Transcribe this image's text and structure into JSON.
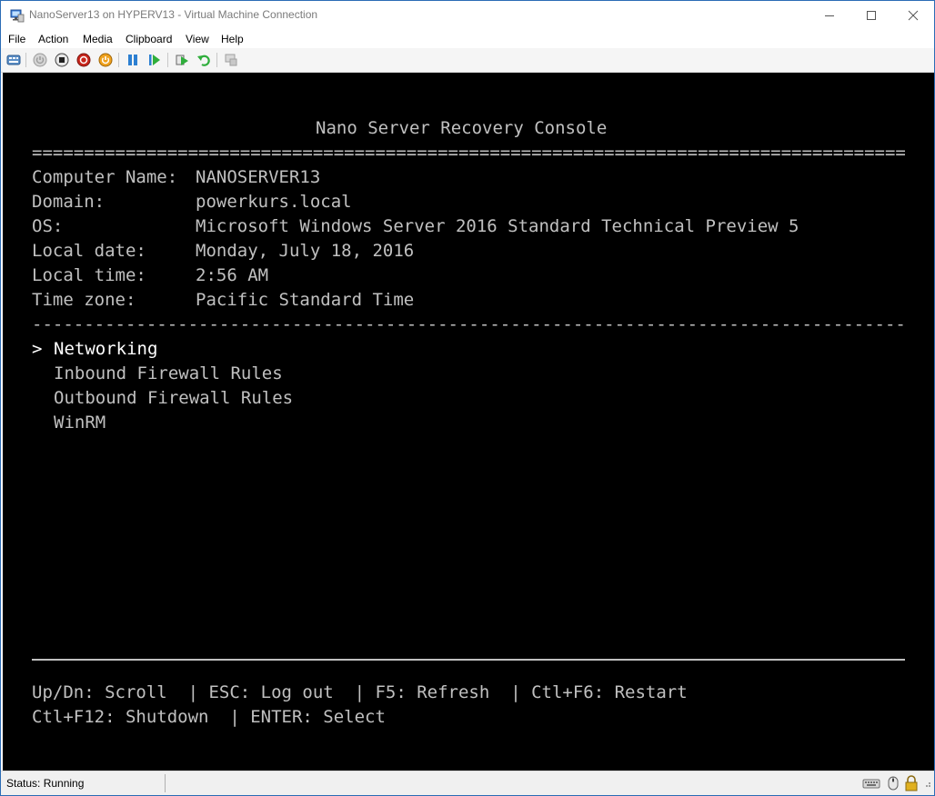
{
  "window": {
    "title": "NanoServer13 on HYPERV13 - Virtual Machine Connection"
  },
  "menu": [
    "File",
    "Action",
    "Media",
    "Clipboard",
    "View",
    "Help"
  ],
  "toolbar_icons": [
    "ctrl-alt-del-icon",
    "start-icon",
    "turn-off-icon",
    "shutdown-icon",
    "power-icon",
    "pause-icon",
    "resume-icon",
    "checkpoint-icon",
    "revert-icon",
    "enhanced-session-icon"
  ],
  "console": {
    "heading": "Nano Server Recovery Console",
    "double_rule": "================================================================================================",
    "info": [
      {
        "label": "Computer Name:",
        "value": "NANOSERVER13"
      },
      {
        "label": "Domain:",
        "value": "powerkurs.local"
      },
      {
        "label": "OS:",
        "value": "Microsoft Windows Server 2016 Standard Technical Preview 5"
      },
      {
        "label": "Local date:",
        "value": "Monday, July 18, 2016"
      },
      {
        "label": "Local time:",
        "value": "2:56 AM"
      },
      {
        "label": "Time zone:",
        "value": "Pacific Standard Time"
      }
    ],
    "dash_rule": "------------------------------------------------------------------------------------------------",
    "cursor": ">",
    "menu_items": [
      "Networking",
      "Inbound Firewall Rules",
      "Outbound Firewall Rules",
      "WinRM"
    ],
    "selected_index": 0,
    "help_line1": "Up/Dn: Scroll  | ESC: Log out  | F5: Refresh  | Ctl+F6: Restart",
    "help_line2": "Ctl+F12: Shutdown  | ENTER: Select"
  },
  "status": {
    "text": "Status: Running"
  },
  "colors": {
    "console_bg": "#000000",
    "console_text": "#c0c0c0",
    "selected_text": "#ffffff",
    "window_border": "#2b6cb5"
  }
}
